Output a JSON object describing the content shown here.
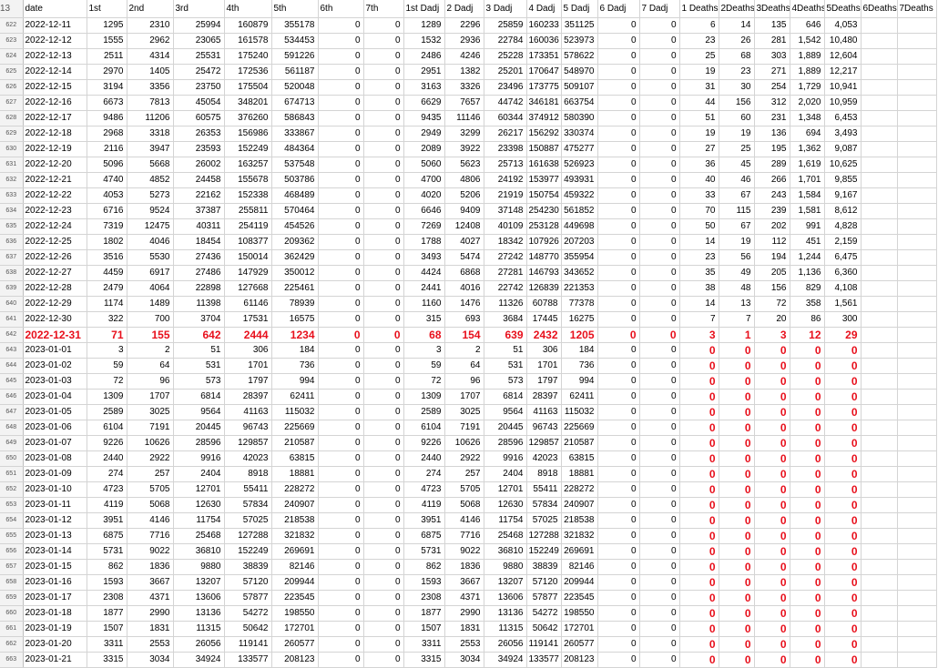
{
  "header_row": {
    "row_number": "13",
    "columns": [
      "date",
      "1st",
      "2nd",
      "3rd",
      "4th",
      "5th",
      "6th",
      "7th",
      "1st Dadj",
      "2 Dadj",
      "3 Dadj",
      "4 Dadj",
      "5 Dadj",
      "6 Dadj",
      "7 Dadj",
      "1 Deaths",
      "2Deaths",
      "3Deaths",
      "4Deaths",
      "5Deaths",
      "6Deaths",
      "7Deaths"
    ]
  },
  "rows": [
    {
      "n": "622",
      "style": "normal",
      "cells": [
        "2022-12-11",
        "1295",
        "2310",
        "25994",
        "160879",
        "355178",
        "0",
        "0",
        "1289",
        "2296",
        "25859",
        "160233",
        "351125",
        "0",
        "0",
        "6",
        "14",
        "135",
        "646",
        "4,053",
        "",
        ""
      ]
    },
    {
      "n": "623",
      "style": "normal",
      "cells": [
        "2022-12-12",
        "1555",
        "2962",
        "23065",
        "161578",
        "534453",
        "0",
        "0",
        "1532",
        "2936",
        "22784",
        "160036",
        "523973",
        "0",
        "0",
        "23",
        "26",
        "281",
        "1,542",
        "10,480",
        "",
        ""
      ]
    },
    {
      "n": "624",
      "style": "normal",
      "cells": [
        "2022-12-13",
        "2511",
        "4314",
        "25531",
        "175240",
        "591226",
        "0",
        "0",
        "2486",
        "4246",
        "25228",
        "173351",
        "578622",
        "0",
        "0",
        "25",
        "68",
        "303",
        "1,889",
        "12,604",
        "",
        ""
      ]
    },
    {
      "n": "625",
      "style": "normal",
      "cells": [
        "2022-12-14",
        "2970",
        "1405",
        "25472",
        "172536",
        "561187",
        "0",
        "0",
        "2951",
        "1382",
        "25201",
        "170647",
        "548970",
        "0",
        "0",
        "19",
        "23",
        "271",
        "1,889",
        "12,217",
        "",
        ""
      ]
    },
    {
      "n": "626",
      "style": "normal",
      "cells": [
        "2022-12-15",
        "3194",
        "3356",
        "23750",
        "175504",
        "520048",
        "0",
        "0",
        "3163",
        "3326",
        "23496",
        "173775",
        "509107",
        "0",
        "0",
        "31",
        "30",
        "254",
        "1,729",
        "10,941",
        "",
        ""
      ]
    },
    {
      "n": "627",
      "style": "normal",
      "cells": [
        "2022-12-16",
        "6673",
        "7813",
        "45054",
        "348201",
        "674713",
        "0",
        "0",
        "6629",
        "7657",
        "44742",
        "346181",
        "663754",
        "0",
        "0",
        "44",
        "156",
        "312",
        "2,020",
        "10,959",
        "",
        ""
      ]
    },
    {
      "n": "628",
      "style": "normal",
      "cells": [
        "2022-12-17",
        "9486",
        "11206",
        "60575",
        "376260",
        "586843",
        "0",
        "0",
        "9435",
        "11146",
        "60344",
        "374912",
        "580390",
        "0",
        "0",
        "51",
        "60",
        "231",
        "1,348",
        "6,453",
        "",
        ""
      ]
    },
    {
      "n": "629",
      "style": "normal",
      "cells": [
        "2022-12-18",
        "2968",
        "3318",
        "26353",
        "156986",
        "333867",
        "0",
        "0",
        "2949",
        "3299",
        "26217",
        "156292",
        "330374",
        "0",
        "0",
        "19",
        "19",
        "136",
        "694",
        "3,493",
        "",
        ""
      ]
    },
    {
      "n": "630",
      "style": "normal",
      "cells": [
        "2022-12-19",
        "2116",
        "3947",
        "23593",
        "152249",
        "484364",
        "0",
        "0",
        "2089",
        "3922",
        "23398",
        "150887",
        "475277",
        "0",
        "0",
        "27",
        "25",
        "195",
        "1,362",
        "9,087",
        "",
        ""
      ]
    },
    {
      "n": "631",
      "style": "normal",
      "cells": [
        "2022-12-20",
        "5096",
        "5668",
        "26002",
        "163257",
        "537548",
        "0",
        "0",
        "5060",
        "5623",
        "25713",
        "161638",
        "526923",
        "0",
        "0",
        "36",
        "45",
        "289",
        "1,619",
        "10,625",
        "",
        ""
      ]
    },
    {
      "n": "632",
      "style": "normal",
      "cells": [
        "2022-12-21",
        "4740",
        "4852",
        "24458",
        "155678",
        "503786",
        "0",
        "0",
        "4700",
        "4806",
        "24192",
        "153977",
        "493931",
        "0",
        "0",
        "40",
        "46",
        "266",
        "1,701",
        "9,855",
        "",
        ""
      ]
    },
    {
      "n": "633",
      "style": "normal",
      "cells": [
        "2022-12-22",
        "4053",
        "5273",
        "22162",
        "152338",
        "468489",
        "0",
        "0",
        "4020",
        "5206",
        "21919",
        "150754",
        "459322",
        "0",
        "0",
        "33",
        "67",
        "243",
        "1,584",
        "9,167",
        "",
        ""
      ]
    },
    {
      "n": "634",
      "style": "normal",
      "cells": [
        "2022-12-23",
        "6716",
        "9524",
        "37387",
        "255811",
        "570464",
        "0",
        "0",
        "6646",
        "9409",
        "37148",
        "254230",
        "561852",
        "0",
        "0",
        "70",
        "115",
        "239",
        "1,581",
        "8,612",
        "",
        ""
      ]
    },
    {
      "n": "635",
      "style": "normal",
      "cells": [
        "2022-12-24",
        "7319",
        "12475",
        "40311",
        "254119",
        "454526",
        "0",
        "0",
        "7269",
        "12408",
        "40109",
        "253128",
        "449698",
        "0",
        "0",
        "50",
        "67",
        "202",
        "991",
        "4,828",
        "",
        ""
      ]
    },
    {
      "n": "636",
      "style": "normal",
      "cells": [
        "2022-12-25",
        "1802",
        "4046",
        "18454",
        "108377",
        "209362",
        "0",
        "0",
        "1788",
        "4027",
        "18342",
        "107926",
        "207203",
        "0",
        "0",
        "14",
        "19",
        "112",
        "451",
        "2,159",
        "",
        ""
      ]
    },
    {
      "n": "637",
      "style": "normal",
      "cells": [
        "2022-12-26",
        "3516",
        "5530",
        "27436",
        "150014",
        "362429",
        "0",
        "0",
        "3493",
        "5474",
        "27242",
        "148770",
        "355954",
        "0",
        "0",
        "23",
        "56",
        "194",
        "1,244",
        "6,475",
        "",
        ""
      ]
    },
    {
      "n": "638",
      "style": "normal",
      "cells": [
        "2022-12-27",
        "4459",
        "6917",
        "27486",
        "147929",
        "350012",
        "0",
        "0",
        "4424",
        "6868",
        "27281",
        "146793",
        "343652",
        "0",
        "0",
        "35",
        "49",
        "205",
        "1,136",
        "6,360",
        "",
        ""
      ]
    },
    {
      "n": "639",
      "style": "normal",
      "cells": [
        "2022-12-28",
        "2479",
        "4064",
        "22898",
        "127668",
        "225461",
        "0",
        "0",
        "2441",
        "4016",
        "22742",
        "126839",
        "221353",
        "0",
        "0",
        "38",
        "48",
        "156",
        "829",
        "4,108",
        "",
        ""
      ]
    },
    {
      "n": "640",
      "style": "normal",
      "cells": [
        "2022-12-29",
        "1174",
        "1489",
        "11398",
        "61146",
        "78939",
        "0",
        "0",
        "1160",
        "1476",
        "11326",
        "60788",
        "77378",
        "0",
        "0",
        "14",
        "13",
        "72",
        "358",
        "1,561",
        "",
        ""
      ]
    },
    {
      "n": "641",
      "style": "normal",
      "cells": [
        "2022-12-30",
        "322",
        "700",
        "3704",
        "17531",
        "16575",
        "0",
        "0",
        "315",
        "693",
        "3684",
        "17445",
        "16275",
        "0",
        "0",
        "7",
        "7",
        "20",
        "86",
        "300",
        "",
        ""
      ]
    },
    {
      "n": "642",
      "style": "allred",
      "cells": [
        "2022-12-31",
        "71",
        "155",
        "642",
        "2444",
        "1234",
        "0",
        "0",
        "68",
        "154",
        "639",
        "2432",
        "1205",
        "0",
        "0",
        "3",
        "1",
        "3",
        "12",
        "29",
        "",
        ""
      ]
    },
    {
      "n": "643",
      "style": "redtail",
      "cells": [
        "2023-01-01",
        "3",
        "2",
        "51",
        "306",
        "184",
        "0",
        "0",
        "3",
        "2",
        "51",
        "306",
        "184",
        "0",
        "0",
        "0",
        "0",
        "0",
        "0",
        "0",
        "",
        ""
      ]
    },
    {
      "n": "644",
      "style": "redtail",
      "cells": [
        "2023-01-02",
        "59",
        "64",
        "531",
        "1701",
        "736",
        "0",
        "0",
        "59",
        "64",
        "531",
        "1701",
        "736",
        "0",
        "0",
        "0",
        "0",
        "0",
        "0",
        "0",
        "",
        ""
      ]
    },
    {
      "n": "645",
      "style": "redtail",
      "cells": [
        "2023-01-03",
        "72",
        "96",
        "573",
        "1797",
        "994",
        "0",
        "0",
        "72",
        "96",
        "573",
        "1797",
        "994",
        "0",
        "0",
        "0",
        "0",
        "0",
        "0",
        "0",
        "",
        ""
      ]
    },
    {
      "n": "646",
      "style": "redtail",
      "cells": [
        "2023-01-04",
        "1309",
        "1707",
        "6814",
        "28397",
        "62411",
        "0",
        "0",
        "1309",
        "1707",
        "6814",
        "28397",
        "62411",
        "0",
        "0",
        "0",
        "0",
        "0",
        "0",
        "0",
        "",
        ""
      ]
    },
    {
      "n": "647",
      "style": "redtail",
      "cells": [
        "2023-01-05",
        "2589",
        "3025",
        "9564",
        "41163",
        "115032",
        "0",
        "0",
        "2589",
        "3025",
        "9564",
        "41163",
        "115032",
        "0",
        "0",
        "0",
        "0",
        "0",
        "0",
        "0",
        "",
        ""
      ]
    },
    {
      "n": "648",
      "style": "redtail",
      "cells": [
        "2023-01-06",
        "6104",
        "7191",
        "20445",
        "96743",
        "225669",
        "0",
        "0",
        "6104",
        "7191",
        "20445",
        "96743",
        "225669",
        "0",
        "0",
        "0",
        "0",
        "0",
        "0",
        "0",
        "",
        ""
      ]
    },
    {
      "n": "649",
      "style": "redtail",
      "cells": [
        "2023-01-07",
        "9226",
        "10626",
        "28596",
        "129857",
        "210587",
        "0",
        "0",
        "9226",
        "10626",
        "28596",
        "129857",
        "210587",
        "0",
        "0",
        "0",
        "0",
        "0",
        "0",
        "0",
        "",
        ""
      ]
    },
    {
      "n": "650",
      "style": "redtail",
      "cells": [
        "2023-01-08",
        "2440",
        "2922",
        "9916",
        "42023",
        "63815",
        "0",
        "0",
        "2440",
        "2922",
        "9916",
        "42023",
        "63815",
        "0",
        "0",
        "0",
        "0",
        "0",
        "0",
        "0",
        "",
        ""
      ]
    },
    {
      "n": "651",
      "style": "redtail",
      "cells": [
        "2023-01-09",
        "274",
        "257",
        "2404",
        "8918",
        "18881",
        "0",
        "0",
        "274",
        "257",
        "2404",
        "8918",
        "18881",
        "0",
        "0",
        "0",
        "0",
        "0",
        "0",
        "0",
        "",
        ""
      ]
    },
    {
      "n": "652",
      "style": "redtail",
      "cells": [
        "2023-01-10",
        "4723",
        "5705",
        "12701",
        "55411",
        "228272",
        "0",
        "0",
        "4723",
        "5705",
        "12701",
        "55411",
        "228272",
        "0",
        "0",
        "0",
        "0",
        "0",
        "0",
        "0",
        "",
        ""
      ]
    },
    {
      "n": "653",
      "style": "redtail",
      "cells": [
        "2023-01-11",
        "4119",
        "5068",
        "12630",
        "57834",
        "240907",
        "0",
        "0",
        "4119",
        "5068",
        "12630",
        "57834",
        "240907",
        "0",
        "0",
        "0",
        "0",
        "0",
        "0",
        "0",
        "",
        ""
      ]
    },
    {
      "n": "654",
      "style": "redtail",
      "cells": [
        "2023-01-12",
        "3951",
        "4146",
        "11754",
        "57025",
        "218538",
        "0",
        "0",
        "3951",
        "4146",
        "11754",
        "57025",
        "218538",
        "0",
        "0",
        "0",
        "0",
        "0",
        "0",
        "0",
        "",
        ""
      ]
    },
    {
      "n": "655",
      "style": "redtail",
      "cells": [
        "2023-01-13",
        "6875",
        "7716",
        "25468",
        "127288",
        "321832",
        "0",
        "0",
        "6875",
        "7716",
        "25468",
        "127288",
        "321832",
        "0",
        "0",
        "0",
        "0",
        "0",
        "0",
        "0",
        "",
        ""
      ]
    },
    {
      "n": "656",
      "style": "redtail",
      "cells": [
        "2023-01-14",
        "5731",
        "9022",
        "36810",
        "152249",
        "269691",
        "0",
        "0",
        "5731",
        "9022",
        "36810",
        "152249",
        "269691",
        "0",
        "0",
        "0",
        "0",
        "0",
        "0",
        "0",
        "",
        ""
      ]
    },
    {
      "n": "657",
      "style": "redtail",
      "cells": [
        "2023-01-15",
        "862",
        "1836",
        "9880",
        "38839",
        "82146",
        "0",
        "0",
        "862",
        "1836",
        "9880",
        "38839",
        "82146",
        "0",
        "0",
        "0",
        "0",
        "0",
        "0",
        "0",
        "",
        ""
      ]
    },
    {
      "n": "658",
      "style": "redtail",
      "cells": [
        "2023-01-16",
        "1593",
        "3667",
        "13207",
        "57120",
        "209944",
        "0",
        "0",
        "1593",
        "3667",
        "13207",
        "57120",
        "209944",
        "0",
        "0",
        "0",
        "0",
        "0",
        "0",
        "0",
        "",
        ""
      ]
    },
    {
      "n": "659",
      "style": "redtail",
      "cells": [
        "2023-01-17",
        "2308",
        "4371",
        "13606",
        "57877",
        "223545",
        "0",
        "0",
        "2308",
        "4371",
        "13606",
        "57877",
        "223545",
        "0",
        "0",
        "0",
        "0",
        "0",
        "0",
        "0",
        "",
        ""
      ]
    },
    {
      "n": "660",
      "style": "redtail",
      "cells": [
        "2023-01-18",
        "1877",
        "2990",
        "13136",
        "54272",
        "198550",
        "0",
        "0",
        "1877",
        "2990",
        "13136",
        "54272",
        "198550",
        "0",
        "0",
        "0",
        "0",
        "0",
        "0",
        "0",
        "",
        ""
      ]
    },
    {
      "n": "661",
      "style": "redtail",
      "cells": [
        "2023-01-19",
        "1507",
        "1831",
        "11315",
        "50642",
        "172701",
        "0",
        "0",
        "1507",
        "1831",
        "11315",
        "50642",
        "172701",
        "0",
        "0",
        "0",
        "0",
        "0",
        "0",
        "0",
        "",
        ""
      ]
    },
    {
      "n": "662",
      "style": "redtail",
      "cells": [
        "2023-01-20",
        "3311",
        "2553",
        "26056",
        "119141",
        "260577",
        "0",
        "0",
        "3311",
        "2553",
        "26056",
        "119141",
        "260577",
        "0",
        "0",
        "0",
        "0",
        "0",
        "0",
        "0",
        "",
        ""
      ]
    },
    {
      "n": "663",
      "style": "redtail",
      "cells": [
        "2023-01-21",
        "3315",
        "3034",
        "34924",
        "133577",
        "208123",
        "0",
        "0",
        "3315",
        "3034",
        "34924",
        "133577",
        "208123",
        "0",
        "0",
        "0",
        "0",
        "0",
        "0",
        "0",
        "",
        ""
      ]
    }
  ],
  "colors": {
    "highlight_red": "#e8101c",
    "grid_line": "#d4d4d4",
    "row_header_bg": "#f3f3f3"
  }
}
